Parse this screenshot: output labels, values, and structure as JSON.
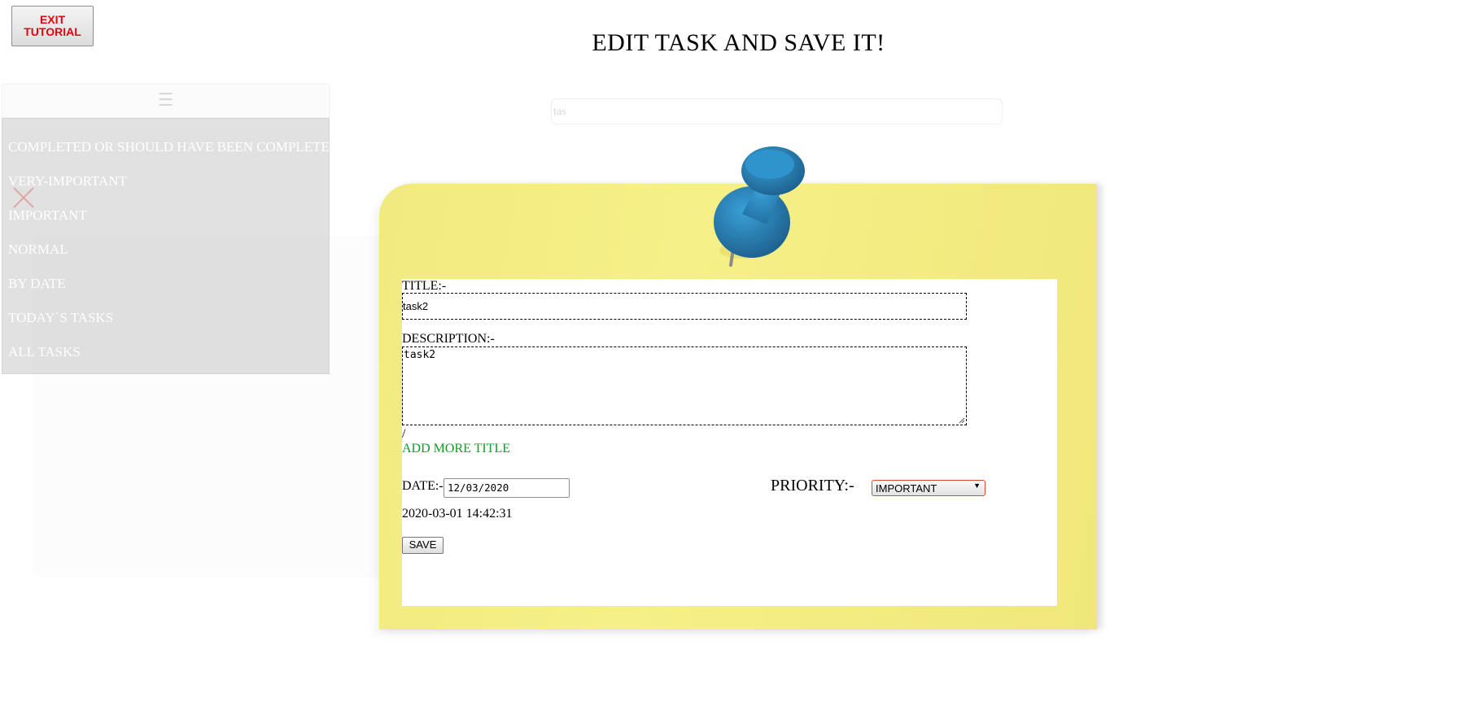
{
  "tutorial": {
    "exit_line1": "EXIT",
    "exit_line2": "TUTORIAL"
  },
  "header": {
    "title": "EDIT TASK AND SAVE IT!"
  },
  "sidebar": {
    "menu_icon": "☰",
    "items": [
      {
        "label": "COMPLETED OR SHOULD HAVE BEEN COMPLETED"
      },
      {
        "label": "VERY-IMPORTANT"
      },
      {
        "label": "IMPORTANT"
      },
      {
        "label": "NORMAL"
      },
      {
        "label": "BY DATE"
      },
      {
        "label": "TODAY`S TASKS"
      },
      {
        "label": "ALL TASKS"
      }
    ]
  },
  "search": {
    "value": "tas"
  },
  "form": {
    "title_label": "TITLE:-",
    "title_value": "task2",
    "description_label": "DESCRIPTION:-",
    "description_value": "task2",
    "slash": "/",
    "add_more_label": "ADD MORE TITLE",
    "date_label": "DATE:-",
    "date_value": "12/03/2020",
    "priority_label": "PRIORITY:-",
    "priority_value": "IMPORTANT",
    "timestamp": "2020-03-01 14:42:31",
    "save_label": "SAVE"
  },
  "colors": {
    "exit_text": "#e3000f",
    "add_more": "#0f9d23",
    "note": "#f3ec82",
    "pin": "#2b87c0"
  },
  "icons": [
    "menu-icon",
    "close-icon",
    "pushpin-icon",
    "dropdown-arrow-icon"
  ]
}
